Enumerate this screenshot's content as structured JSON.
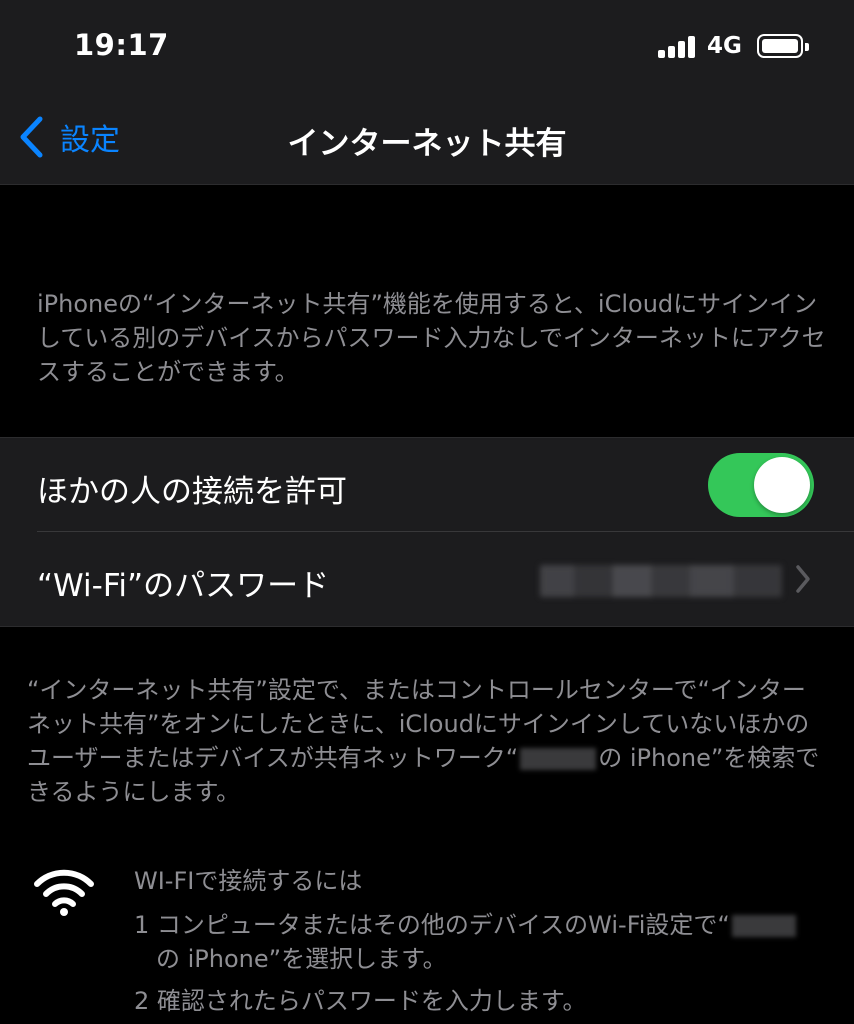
{
  "status_bar": {
    "time": "19:17",
    "network": "4G",
    "signal_bars": 4,
    "battery_level": 1.0
  },
  "nav": {
    "back_label": "設定",
    "title": "インターネット共有",
    "accent_color": "#0a84ff"
  },
  "intro_text": "iPhoneの“インターネット共有”機能を使用すると、iCloudにサインインしている別のデバイスからパスワード入力なしでインターネットにアクセスすることができます。",
  "settings": {
    "allow_others_label": "ほかの人の接続を許可",
    "allow_others_enabled": true,
    "toggle_on_color": "#34c759",
    "wifi_password_label": "“Wi-Fi”のパスワード"
  },
  "footer": {
    "text_part1": "“インターネット共有”設定で、またはコントロールセンターで“インターネット共有”をオンにしたときに、iCloudにサインインしていないほかのユーザーまたはデバイスが共有ネットワーク“",
    "text_part2": "の iPhone”を検索できるようにします。"
  },
  "wifi_instructions": {
    "icon": "wifi-icon",
    "heading": "WI-FIで接続するには",
    "step1_part1": "1 コンピュータまたはその他のデバイスのWi-Fi設定で“",
    "step1_part2": "の iPhone”を選択します。",
    "step2": "2 確認されたらパスワードを入力します。"
  }
}
